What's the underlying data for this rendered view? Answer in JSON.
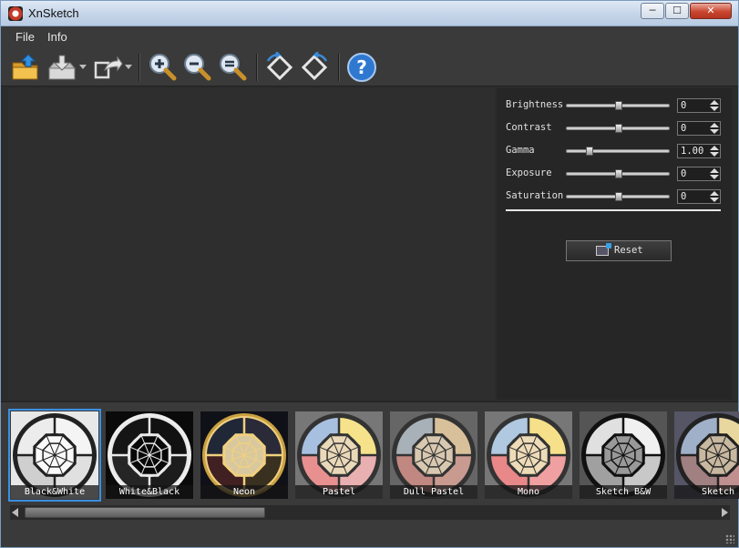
{
  "window": {
    "title": "XnSketch",
    "minimize_label": "─",
    "maximize_label": "☐",
    "close_label": "✕"
  },
  "menu": [
    "File",
    "Info"
  ],
  "toolbar": {
    "icons": [
      "open-folder",
      "save",
      "export",
      "zoom-in",
      "zoom-out",
      "zoom-fit",
      "rotate-left",
      "rotate-right",
      "help"
    ]
  },
  "adjustments": [
    {
      "label": "Brightness",
      "value": "0",
      "level": 0.5
    },
    {
      "label": "Contrast",
      "value": "0",
      "level": 0.5
    },
    {
      "label": "Gamma",
      "value": "1.00",
      "level": 0.2
    },
    {
      "label": "Exposure",
      "value": "0",
      "level": 0.5
    },
    {
      "label": "Saturation",
      "value": "0",
      "level": 0.5
    }
  ],
  "reset_label": "Reset",
  "presets": [
    {
      "label": "Black&White",
      "selected": true
    },
    {
      "label": "White&Black",
      "selected": false
    },
    {
      "label": "Neon",
      "selected": false
    },
    {
      "label": "Pastel",
      "selected": false
    },
    {
      "label": "Dull Pastel",
      "selected": false
    },
    {
      "label": "Mono",
      "selected": false
    },
    {
      "label": "Sketch B&W",
      "selected": false
    },
    {
      "label": "Sketch",
      "selected": false
    }
  ],
  "colors": {
    "accent": "#3b8fe0",
    "background": "#2b2b2b",
    "panel": "#262626"
  },
  "scroll_position": 0.0
}
